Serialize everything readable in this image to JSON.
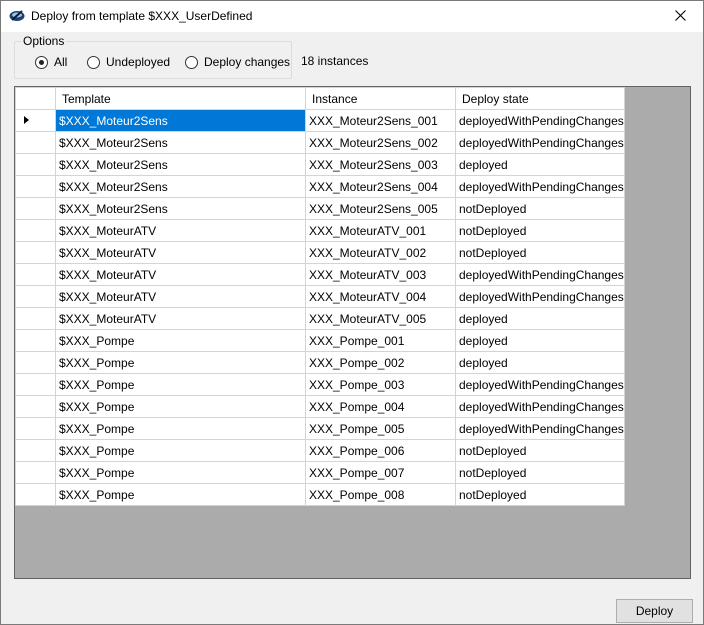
{
  "window": {
    "title": "Deploy from template $XXX_UserDefined",
    "icon": "app-icon",
    "close_icon": "close-icon"
  },
  "options": {
    "legend": "Options",
    "radios": [
      {
        "label": "All",
        "checked": true
      },
      {
        "label": "Undeployed",
        "checked": false
      },
      {
        "label": "Deploy changes",
        "checked": false
      }
    ]
  },
  "instance_count": "18 instances",
  "grid": {
    "columns": [
      "Template",
      "Instance",
      "Deploy state"
    ],
    "selected_row": 0,
    "rows": [
      [
        "$XXX_Moteur2Sens",
        "XXX_Moteur2Sens_001",
        "deployedWithPendingChanges"
      ],
      [
        "$XXX_Moteur2Sens",
        "XXX_Moteur2Sens_002",
        "deployedWithPendingChanges"
      ],
      [
        "$XXX_Moteur2Sens",
        "XXX_Moteur2Sens_003",
        "deployed"
      ],
      [
        "$XXX_Moteur2Sens",
        "XXX_Moteur2Sens_004",
        "deployedWithPendingChanges"
      ],
      [
        "$XXX_Moteur2Sens",
        "XXX_Moteur2Sens_005",
        "notDeployed"
      ],
      [
        "$XXX_MoteurATV",
        "XXX_MoteurATV_001",
        "notDeployed"
      ],
      [
        "$XXX_MoteurATV",
        "XXX_MoteurATV_002",
        "notDeployed"
      ],
      [
        "$XXX_MoteurATV",
        "XXX_MoteurATV_003",
        "deployedWithPendingChanges"
      ],
      [
        "$XXX_MoteurATV",
        "XXX_MoteurATV_004",
        "deployedWithPendingChanges"
      ],
      [
        "$XXX_MoteurATV",
        "XXX_MoteurATV_005",
        "deployed"
      ],
      [
        "$XXX_Pompe",
        "XXX_Pompe_001",
        "deployed"
      ],
      [
        "$XXX_Pompe",
        "XXX_Pompe_002",
        "deployed"
      ],
      [
        "$XXX_Pompe",
        "XXX_Pompe_003",
        "deployedWithPendingChanges"
      ],
      [
        "$XXX_Pompe",
        "XXX_Pompe_004",
        "deployedWithPendingChanges"
      ],
      [
        "$XXX_Pompe",
        "XXX_Pompe_005",
        "deployedWithPendingChanges"
      ],
      [
        "$XXX_Pompe",
        "XXX_Pompe_006",
        "notDeployed"
      ],
      [
        "$XXX_Pompe",
        "XXX_Pompe_007",
        "notDeployed"
      ],
      [
        "$XXX_Pompe",
        "XXX_Pompe_008",
        "notDeployed"
      ]
    ]
  },
  "buttons": {
    "deploy": "Deploy"
  },
  "colors": {
    "selection": "#0078d7",
    "grid_background": "#ababab"
  }
}
